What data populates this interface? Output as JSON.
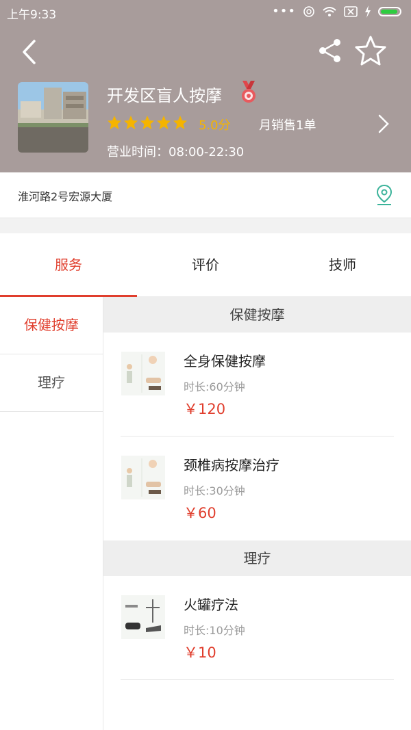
{
  "status_bar": {
    "time": "上午9:33",
    "dots": "•••"
  },
  "header": {
    "shop_name": "开发区盲人按摩",
    "rating_stars": 5,
    "score": "5.0分",
    "monthly_sales": "月销售1单",
    "hours": "营业时间：08:00-22:30"
  },
  "address": "淮河路2号宏源大厦",
  "tabs": [
    {
      "label": "服务"
    },
    {
      "label": "评价"
    },
    {
      "label": "技师"
    }
  ],
  "sidebar": [
    {
      "label": "保健按摩"
    },
    {
      "label": "理疗"
    }
  ],
  "sections": [
    {
      "title": "保健按摩",
      "items": [
        {
          "name": "全身保健按摩",
          "duration": "时长:60分钟",
          "price": "￥120"
        },
        {
          "name": "颈椎病按摩治疗",
          "duration": "时长:30分钟",
          "price": "￥60"
        }
      ]
    },
    {
      "title": "理疗",
      "items": [
        {
          "name": "火罐疗法",
          "duration": "时长:10分钟",
          "price": "￥10"
        }
      ]
    }
  ],
  "colors": {
    "header_bg": "#a89c9b",
    "accent": "#e03e2d",
    "star": "#f5b400",
    "location": "#3bb39a"
  }
}
